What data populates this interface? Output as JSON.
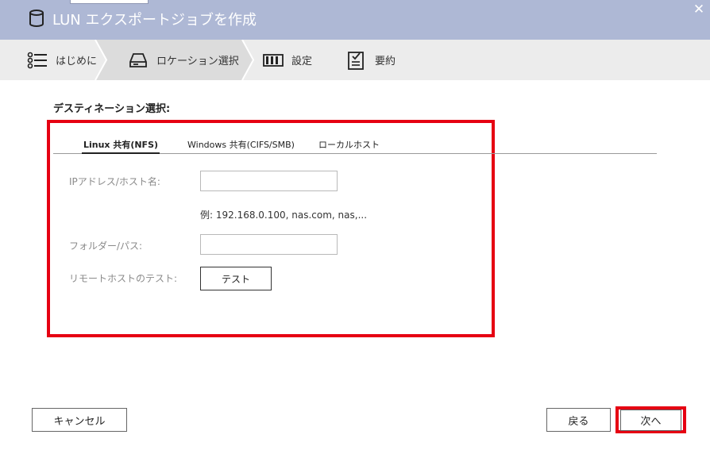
{
  "window": {
    "title": "LUN エクスポートジョブを作成",
    "close_label": "✕"
  },
  "steps": [
    {
      "label": "はじめに",
      "icon": "list-icon"
    },
    {
      "label": "ロケーション選択",
      "icon": "drive-icon"
    },
    {
      "label": "設定",
      "icon": "settings-bars-icon"
    },
    {
      "label": "要約",
      "icon": "summary-checklist-icon"
    }
  ],
  "destination": {
    "title": "デスティネーション選択:",
    "tabs": [
      {
        "label": "Linux 共有(NFS)",
        "active": true
      },
      {
        "label": "Windows 共有(CIFS/SMB)",
        "active": false
      },
      {
        "label": "ローカルホスト",
        "active": false
      }
    ],
    "ip_label": "IPアドレス/ホスト名:",
    "ip_value": "",
    "ip_hint": "例: 192.168.0.100, nas.com, nas,...",
    "folder_label": "フォルダー/パス:",
    "folder_value": "",
    "test_label": "リモートホストのテスト:",
    "test_button": "テスト"
  },
  "footer": {
    "cancel": "キャンセル",
    "back": "戻る",
    "next": "次へ"
  },
  "colors": {
    "titlebar": "#aeb8d5",
    "highlight": "#e60012",
    "steps_bg": "#ececec",
    "active_step_bg": "#dcdcdc"
  }
}
